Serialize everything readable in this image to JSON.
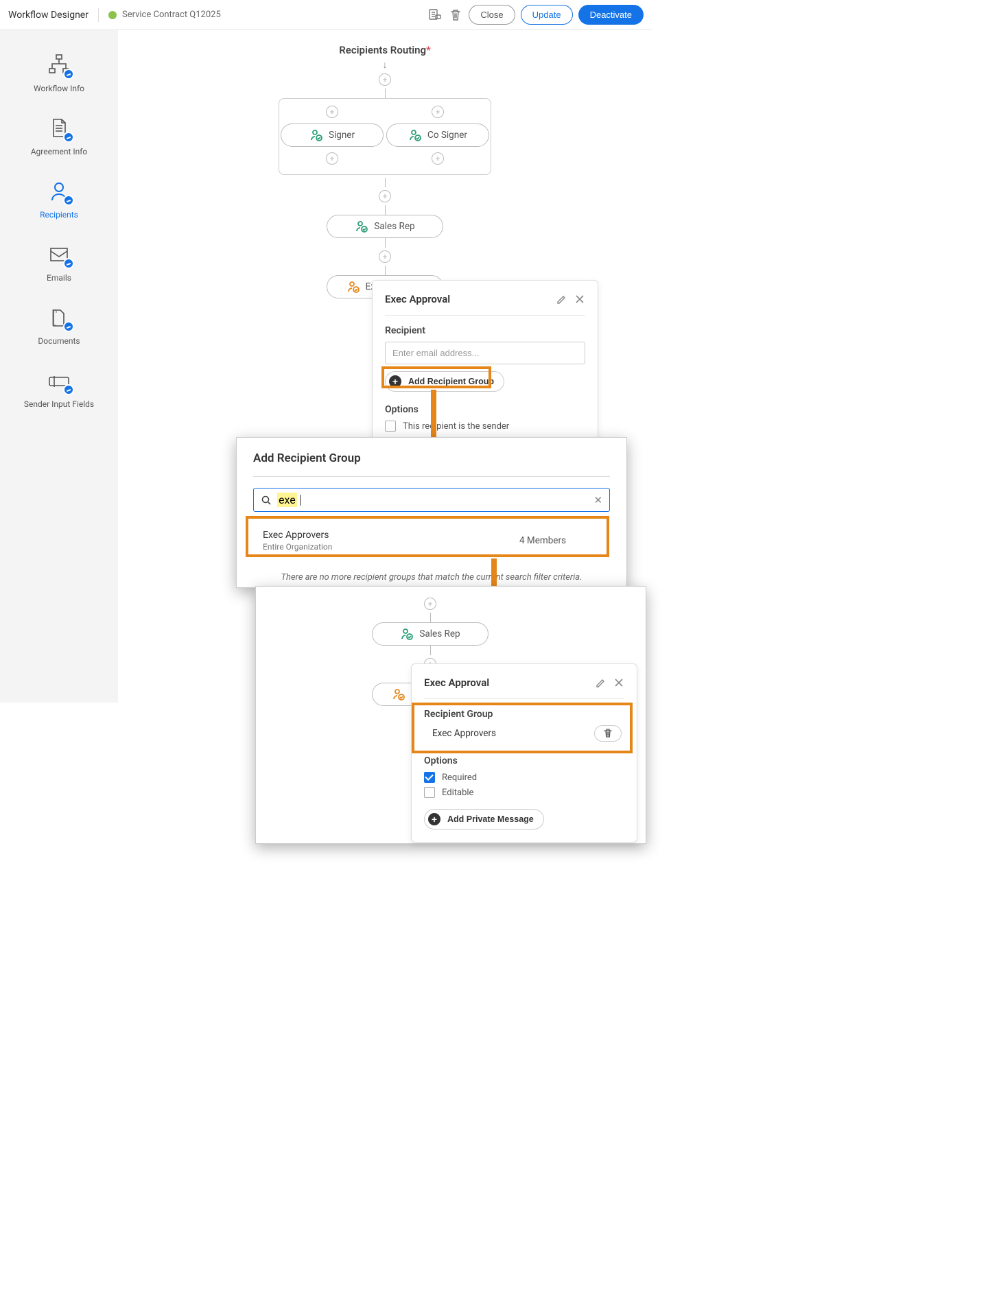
{
  "header": {
    "title": "Workflow Designer",
    "workflow_name": "Service Contract Q12025",
    "close": "Close",
    "update": "Update",
    "deactivate": "Deactivate"
  },
  "sidebar": {
    "items": [
      {
        "label": "Workflow Info"
      },
      {
        "label": "Agreement Info"
      },
      {
        "label": "Recipients"
      },
      {
        "label": "Emails"
      },
      {
        "label": "Documents"
      },
      {
        "label": "Sender Input Fields"
      }
    ]
  },
  "canvas": {
    "title": "Recipients Routing",
    "required_marker": "*",
    "roles": {
      "signer": "Signer",
      "co_signer": "Co Signer",
      "sales_rep": "Sales Rep",
      "exec_approval": "Exec Approval"
    }
  },
  "panel1": {
    "title": "Exec Approval",
    "recipient_label": "Recipient",
    "email_placeholder": "Enter email address...",
    "add_group": "Add Recipient Group",
    "options_label": "Options",
    "opt_sender": "This recipient is the sender"
  },
  "modal": {
    "title": "Add Recipient Group",
    "search_value": "exe",
    "result_name": "Exec Approvers",
    "result_sub": "Entire Organization",
    "result_members": "4 Members",
    "no_more": "There are no more recipient groups that match the current search filter criteria."
  },
  "panel2": {
    "title": "Exec Approval",
    "group_label": "Recipient Group",
    "group_value": "Exec Approvers",
    "options_label": "Options",
    "opt_required": "Required",
    "opt_editable": "Editable",
    "add_private": "Add Private Message"
  }
}
